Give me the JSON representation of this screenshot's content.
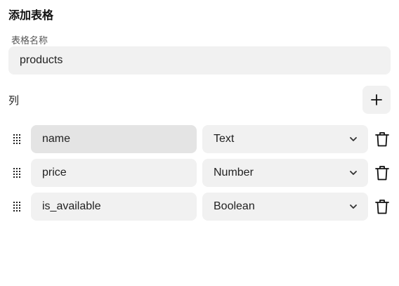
{
  "dialog": {
    "title": "添加表格",
    "table_name_label": "表格名称",
    "table_name_value": "products",
    "columns_label": "列",
    "add_column_icon": "plus-icon"
  },
  "columns": [
    {
      "name": "name",
      "type": "Text",
      "focused": true
    },
    {
      "name": "price",
      "type": "Number",
      "focused": false
    },
    {
      "name": "is_available",
      "type": "Boolean",
      "focused": false
    }
  ],
  "icons": {
    "drag": "drag-handle-icon",
    "dropdown": "chevron-down-icon",
    "delete": "trash-icon"
  },
  "colors": {
    "field_bg": "#f1f1f1",
    "focused_field_bg": "#e4e4e4",
    "text": "#222222"
  }
}
